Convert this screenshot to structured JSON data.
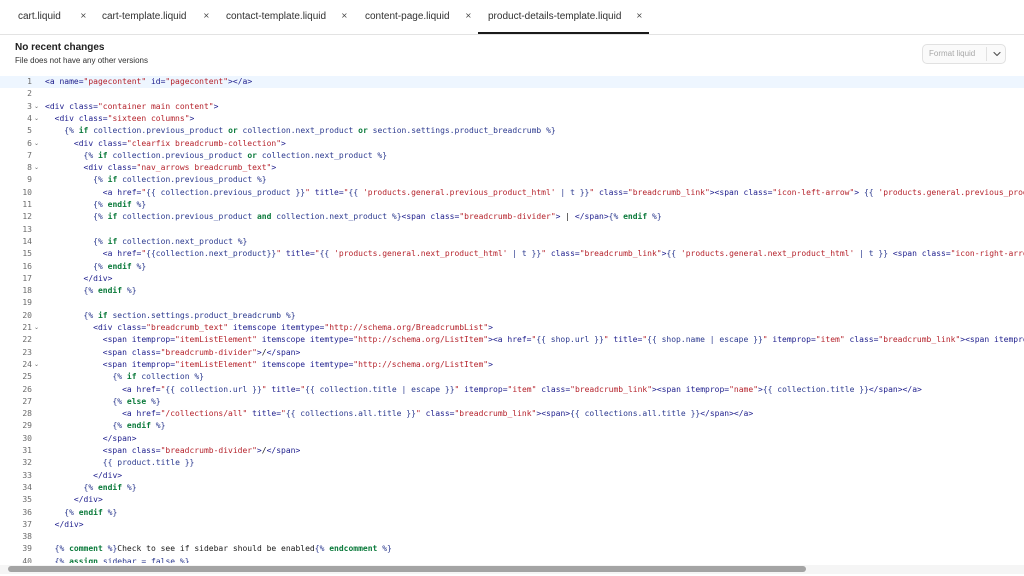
{
  "tabs": [
    {
      "label": "cart.liquid",
      "close": "×",
      "active": false
    },
    {
      "label": "cart-template.liquid",
      "close": "×",
      "active": false
    },
    {
      "label": "contact-template.liquid",
      "close": "×",
      "active": false
    },
    {
      "label": "content-page.liquid",
      "close": "×",
      "active": false
    },
    {
      "label": "product-details-template.liquid",
      "close": "×",
      "active": true
    }
  ],
  "status": {
    "title": "No recent changes",
    "subtitle": "File does not have any other versions"
  },
  "format_button": {
    "label": "Format liquid",
    "icon": "chevron-down-icon"
  },
  "editor": {
    "active_line": 1,
    "lines": [
      {
        "n": "1",
        "fold": false,
        "text": "<a name=\"pagecontent\" id=\"pagecontent\"></a>"
      },
      {
        "n": "2",
        "fold": false,
        "text": ""
      },
      {
        "n": "3",
        "fold": true,
        "text": "<div class=\"container main content\">"
      },
      {
        "n": "4",
        "fold": true,
        "text": "  <div class=\"sixteen columns\">"
      },
      {
        "n": "5",
        "fold": false,
        "text": "    {% if collection.previous_product or collection.next_product or section.settings.product_breadcrumb %}"
      },
      {
        "n": "6",
        "fold": true,
        "text": "      <div class=\"clearfix breadcrumb-collection\">"
      },
      {
        "n": "7",
        "fold": false,
        "text": "        {% if collection.previous_product or collection.next_product %}"
      },
      {
        "n": "8",
        "fold": true,
        "text": "        <div class=\"nav_arrows breadcrumb_text\">"
      },
      {
        "n": "9",
        "fold": false,
        "text": "          {% if collection.previous_product %}"
      },
      {
        "n": "10",
        "fold": false,
        "text": "            <a href=\"{{ collection.previous_product }}\" title=\"{{ 'products.general.previous_product_html' | t }}\" class=\"breadcrumb_link\"><span class=\"icon-left-arrow\"> {{ 'products.general.previous_product_html' | t }}</span></a>"
      },
      {
        "n": "11",
        "fold": false,
        "text": "          {% endif %}"
      },
      {
        "n": "12",
        "fold": false,
        "text": "          {% if collection.previous_product and collection.next_product %}<span class=\"breadcrumb-divider\"> | </span>{% endif %}"
      },
      {
        "n": "13",
        "fold": false,
        "text": ""
      },
      {
        "n": "14",
        "fold": false,
        "text": "          {% if collection.next_product %}"
      },
      {
        "n": "15",
        "fold": false,
        "text": "            <a href=\"{{collection.next_product}}\" title=\"{{ 'products.general.next_product_html' | t }}\" class=\"breadcrumb_link\">{{ 'products.general.next_product_html' | t }} <span class=\"icon-right-arrow\"></span></a>"
      },
      {
        "n": "16",
        "fold": false,
        "text": "          {% endif %}"
      },
      {
        "n": "17",
        "fold": false,
        "text": "        </div>"
      },
      {
        "n": "18",
        "fold": false,
        "text": "        {% endif %}"
      },
      {
        "n": "19",
        "fold": false,
        "text": ""
      },
      {
        "n": "20",
        "fold": false,
        "text": "        {% if section.settings.product_breadcrumb %}"
      },
      {
        "n": "21",
        "fold": true,
        "text": "          <div class=\"breadcrumb_text\" itemscope itemtype=\"http://schema.org/BreadcrumbList\">"
      },
      {
        "n": "22",
        "fold": false,
        "text": "            <span itemprop=\"itemListElement\" itemscope itemtype=\"http://schema.org/ListItem\"><a href=\"{{ shop.url }}\" title=\"{{ shop.name | escape }}\" itemprop=\"item\" class=\"breadcrumb_link\"><span itemprop=\"name\">{{ 'general.breadcrumbs.home' | t }}</span></a></span>"
      },
      {
        "n": "23",
        "fold": false,
        "text": "            <span class=\"breadcrumb-divider\">/</span>"
      },
      {
        "n": "24",
        "fold": true,
        "text": "            <span itemprop=\"itemListElement\" itemscope itemtype=\"http://schema.org/ListItem\">"
      },
      {
        "n": "25",
        "fold": false,
        "text": "              {% if collection %}"
      },
      {
        "n": "26",
        "fold": false,
        "text": "                <a href=\"{{ collection.url }}\" title=\"{{ collection.title | escape }}\" itemprop=\"item\" class=\"breadcrumb_link\"><span itemprop=\"name\">{{ collection.title }}</span></a>"
      },
      {
        "n": "27",
        "fold": false,
        "text": "              {% else %}"
      },
      {
        "n": "28",
        "fold": false,
        "text": "                <a href=\"/collections/all\" title=\"{{ collections.all.title }}\" class=\"breadcrumb_link\"><span>{{ collections.all.title }}</span></a>"
      },
      {
        "n": "29",
        "fold": false,
        "text": "              {% endif %}"
      },
      {
        "n": "30",
        "fold": false,
        "text": "            </span>"
      },
      {
        "n": "31",
        "fold": false,
        "text": "            <span class=\"breadcrumb-divider\">/</span>"
      },
      {
        "n": "32",
        "fold": false,
        "text": "            {{ product.title }}"
      },
      {
        "n": "33",
        "fold": false,
        "text": "          </div>"
      },
      {
        "n": "34",
        "fold": false,
        "text": "        {% endif %}"
      },
      {
        "n": "35",
        "fold": false,
        "text": "      </div>"
      },
      {
        "n": "36",
        "fold": false,
        "text": "    {% endif %}"
      },
      {
        "n": "37",
        "fold": false,
        "text": "  </div>"
      },
      {
        "n": "38",
        "fold": false,
        "text": ""
      },
      {
        "n": "39",
        "fold": false,
        "text": "  {% comment %}Check to see if sidebar should be enabled{% endcomment %}"
      },
      {
        "n": "40",
        "fold": false,
        "text": "  {% assign sidebar = false %}"
      }
    ]
  },
  "colors": {
    "tag": "#1d1d8c",
    "string": "#b5232c",
    "keyword": "#0b7a3b",
    "liquid": "#2c3a8f",
    "active_line": "#eef6ff"
  }
}
